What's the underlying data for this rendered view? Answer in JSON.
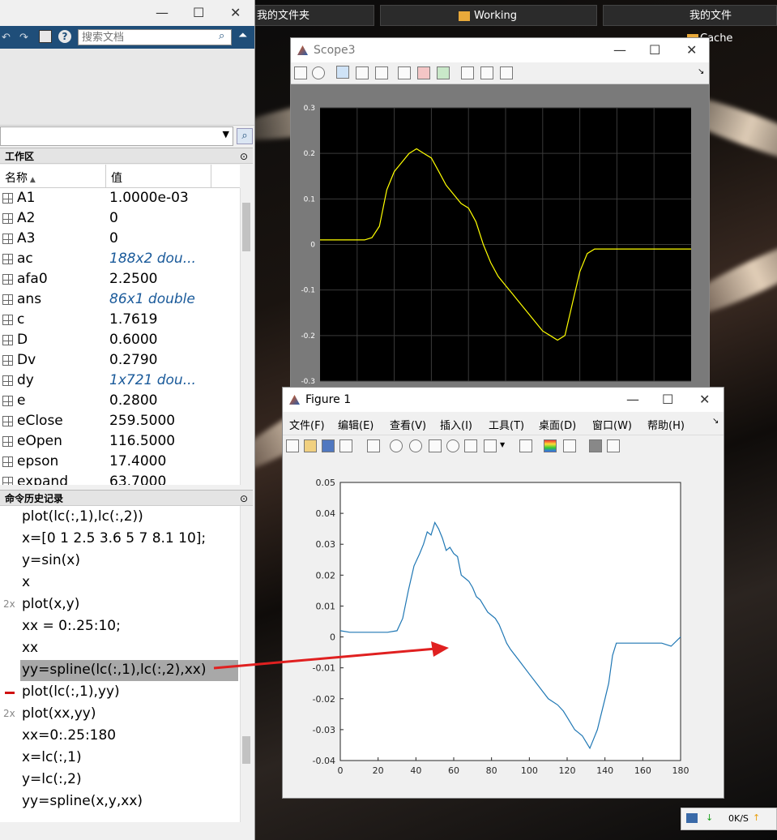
{
  "desktop": {
    "taskbar_left": "我的文件夹",
    "taskbar_mid": "Working",
    "taskbar_right": "我的文件",
    "folder_label": "Cache",
    "net_speed": "0K/S"
  },
  "matlab": {
    "search_placeholder": "搜索文档",
    "workspace_title": "工作区",
    "col_name": "名称",
    "col_value": "值",
    "workspace": [
      {
        "name": "A1",
        "value": "1.0000e-03",
        "italic": false
      },
      {
        "name": "A2",
        "value": "0",
        "italic": false
      },
      {
        "name": "A3",
        "value": "0",
        "italic": false
      },
      {
        "name": "ac",
        "value": "188x2 dou...",
        "italic": true
      },
      {
        "name": "afa0",
        "value": "2.2500",
        "italic": false
      },
      {
        "name": "ans",
        "value": "86x1 double",
        "italic": true
      },
      {
        "name": "c",
        "value": "1.7619",
        "italic": false
      },
      {
        "name": "D",
        "value": "0.6000",
        "italic": false
      },
      {
        "name": "Dv",
        "value": "0.2790",
        "italic": false
      },
      {
        "name": "dy",
        "value": "1x721 dou...",
        "italic": true
      },
      {
        "name": "e",
        "value": "0.2800",
        "italic": false
      },
      {
        "name": "eClose",
        "value": "259.5000",
        "italic": false
      },
      {
        "name": "eOpen",
        "value": "116.5000",
        "italic": false
      },
      {
        "name": "epson",
        "value": "17.4000",
        "italic": false
      },
      {
        "name": "expand",
        "value": "63.7000",
        "italic": false
      }
    ],
    "history_title": "命令历史记录",
    "history": [
      {
        "text": "plot(lc(:,1),lc(:,2))",
        "mark": ""
      },
      {
        "text": "x=[0 1 2.5 3.6 5 7 8.1 10];",
        "mark": ""
      },
      {
        "text": "y=sin(x)",
        "mark": ""
      },
      {
        "text": "x",
        "mark": ""
      },
      {
        "text": "plot(x,y)",
        "mark": "2x"
      },
      {
        "text": "xx = 0:.25:10;",
        "mark": ""
      },
      {
        "text": "xx",
        "mark": ""
      },
      {
        "text": "yy=spline(lc(:,1),lc(:,2),xx)",
        "mark": ""
      },
      {
        "text": "plot(lc(:,1),yy)",
        "mark": "-"
      },
      {
        "text": "plot(xx,yy)",
        "mark": "2x"
      },
      {
        "text": "xx=0:.25:180",
        "mark": ""
      },
      {
        "text": "x=lc(:,1)",
        "mark": ""
      },
      {
        "text": "y=lc(:,2)",
        "mark": ""
      },
      {
        "text": "yy=spline(x,y,xx)",
        "mark": ""
      }
    ]
  },
  "scope": {
    "title": "Scope3",
    "yticks": [
      "0.3",
      "0.2",
      "0.1",
      "0",
      "-0.1",
      "-0.2",
      "-0.3"
    ]
  },
  "figure": {
    "title": "Figure 1",
    "menus": [
      "文件(F)",
      "编辑(E)",
      "查看(V)",
      "插入(I)",
      "工具(T)",
      "桌面(D)",
      "窗口(W)",
      "帮助(H)"
    ]
  },
  "chart_data": [
    {
      "type": "line",
      "title": "",
      "xlabel": "",
      "ylabel": "",
      "ylim": [
        -0.3,
        0.3
      ],
      "grid": true,
      "background": "#000000",
      "series": [
        {
          "color": "#ffff00",
          "x": [
            0,
            5,
            10,
            12,
            14,
            16,
            18,
            20,
            22,
            24,
            26,
            28,
            30,
            32,
            34,
            36,
            38,
            40,
            42,
            44,
            46,
            48,
            50,
            52,
            54,
            56,
            58,
            60,
            62,
            64,
            66,
            68,
            70,
            72,
            74,
            76,
            78,
            80,
            82,
            84,
            86,
            88,
            90,
            92,
            94,
            96,
            98,
            100
          ],
          "values": [
            0.01,
            0.01,
            0.01,
            0.01,
            0.015,
            0.04,
            0.12,
            0.16,
            0.18,
            0.2,
            0.21,
            0.2,
            0.19,
            0.16,
            0.13,
            0.11,
            0.09,
            0.08,
            0.05,
            0.0,
            -0.04,
            -0.07,
            -0.09,
            -0.11,
            -0.13,
            -0.15,
            -0.17,
            -0.19,
            -0.2,
            -0.21,
            -0.2,
            -0.13,
            -0.06,
            -0.02,
            -0.01,
            -0.01,
            -0.01,
            -0.01,
            -0.01,
            -0.01,
            -0.01,
            -0.01,
            -0.01,
            -0.01,
            -0.01,
            -0.01,
            -0.01,
            -0.01
          ]
        }
      ]
    },
    {
      "type": "line",
      "title": "",
      "xlabel": "",
      "ylabel": "",
      "xlim": [
        0,
        180
      ],
      "ylim": [
        -0.04,
        0.05
      ],
      "xticks": [
        "0",
        "20",
        "40",
        "60",
        "80",
        "100",
        "120",
        "140",
        "160",
        "180"
      ],
      "yticks": [
        "0.05",
        "0.04",
        "0.03",
        "0.02",
        "0.01",
        "0",
        "-0.01",
        "-0.02",
        "-0.03",
        "-0.04"
      ],
      "grid": false,
      "series": [
        {
          "color": "#1f77b4",
          "x": [
            0,
            5,
            10,
            15,
            20,
            25,
            30,
            33,
            36,
            39,
            42,
            44,
            46,
            48,
            50,
            52,
            54,
            56,
            58,
            60,
            62,
            64,
            66,
            68,
            70,
            72,
            74,
            76,
            78,
            80,
            82,
            84,
            86,
            88,
            90,
            95,
            100,
            105,
            110,
            115,
            118,
            120,
            122,
            124,
            126,
            128,
            130,
            132,
            134,
            136,
            138,
            140,
            142,
            144,
            146,
            150,
            155,
            160,
            165,
            170,
            175,
            180
          ],
          "values": [
            0.002,
            0.0015,
            0.0015,
            0.0015,
            0.0015,
            0.0015,
            0.002,
            0.006,
            0.015,
            0.023,
            0.027,
            0.03,
            0.034,
            0.033,
            0.037,
            0.035,
            0.032,
            0.028,
            0.029,
            0.027,
            0.026,
            0.02,
            0.019,
            0.018,
            0.016,
            0.013,
            0.012,
            0.01,
            0.008,
            0.007,
            0.006,
            0.004,
            0.001,
            -0.002,
            -0.004,
            -0.008,
            -0.012,
            -0.016,
            -0.02,
            -0.022,
            -0.024,
            -0.026,
            -0.028,
            -0.03,
            -0.031,
            -0.032,
            -0.034,
            -0.036,
            -0.033,
            -0.03,
            -0.025,
            -0.02,
            -0.015,
            -0.006,
            -0.002,
            -0.002,
            -0.002,
            -0.002,
            -0.002,
            -0.002,
            -0.003,
            0.0
          ]
        }
      ]
    }
  ]
}
